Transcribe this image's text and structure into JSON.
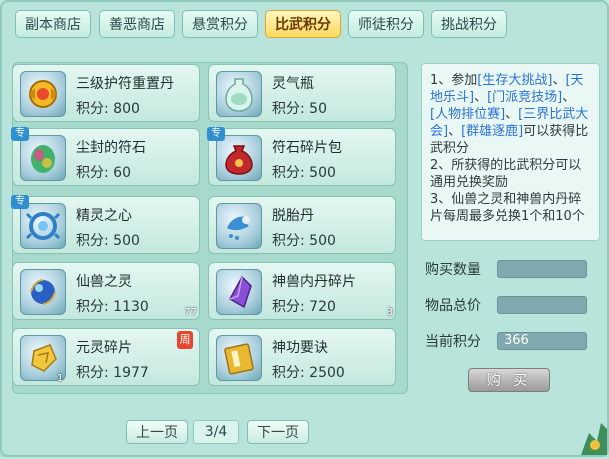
{
  "tabs": [
    {
      "label": "副本商店"
    },
    {
      "label": "善恶商店"
    },
    {
      "label": "悬赏积分"
    },
    {
      "label": "比武积分"
    },
    {
      "label": "师徒积分"
    },
    {
      "label": "挑战积分"
    }
  ],
  "active_tab": "比武积分",
  "items": [
    {
      "name": "三级护符重置丹",
      "score": "积分: 800",
      "icon": "golden-amulet-icon",
      "badge": "",
      "qty": ""
    },
    {
      "name": "灵气瓶",
      "score": "积分: 50",
      "icon": "spirit-vase-icon",
      "badge": "",
      "qty": ""
    },
    {
      "name": "尘封的符石",
      "score": "积分: 60",
      "icon": "sealed-rune-stone-icon",
      "badge": "专",
      "qty": ""
    },
    {
      "name": "符石碎片包",
      "score": "积分: 500",
      "icon": "rune-fragment-bag-icon",
      "badge": "专",
      "qty": ""
    },
    {
      "name": "精灵之心",
      "score": "积分: 500",
      "icon": "spirit-heart-icon",
      "badge": "专",
      "qty": ""
    },
    {
      "name": "脱胎丹",
      "score": "积分: 500",
      "icon": "rebirth-pill-icon",
      "badge": "",
      "qty": ""
    },
    {
      "name": "仙兽之灵",
      "score": "积分: 1130",
      "icon": "beast-spirit-orb-icon",
      "badge": "",
      "qty": "77"
    },
    {
      "name": "神兽内丹碎片",
      "score": "积分: 720",
      "icon": "beast-core-shard-icon",
      "badge": "",
      "qty": "3"
    },
    {
      "name": "元灵碎片",
      "score": "积分: 1977",
      "icon": "yuanling-shard-icon",
      "badge": "",
      "qty": "1",
      "weekly": "周"
    },
    {
      "name": "神功要诀",
      "score": "积分: 2500",
      "icon": "martial-manual-icon",
      "badge": "",
      "qty": ""
    }
  ],
  "info": {
    "p1": "1、参加",
    "l1": "[生存大挑战]",
    "s1": "、",
    "l2": "[天地乐斗]",
    "s2": "、",
    "l3": "[门派竞技场]",
    "s3": "、",
    "l4": "[人物排位赛]",
    "s4": "、",
    "l5": "[三界比武大会]",
    "s5": "、",
    "l6": "[群雄逐鹿]",
    "p1_end": "可以获得比武积分",
    "p2": "2、所获得的比武积分可以通用兑换奖励",
    "p3": "3、仙兽之灵和神兽内丹碎片每周最多兑换1个和10个"
  },
  "form": {
    "qty_label": "购买数量",
    "qty_value": "",
    "total_label": "物品总价",
    "total_value": "",
    "current_label": "当前积分",
    "current_value": "366",
    "buy_label": "购 买"
  },
  "pager": {
    "prev": "上一页",
    "indicator": "3/4",
    "next": "下一页"
  },
  "colors": {
    "panel": "#b9e4dc",
    "active_tab": "#ffd85c",
    "link": "#2a73d6",
    "weekly_badge": "#e8452f",
    "special_badge": "#2f8fcf"
  }
}
